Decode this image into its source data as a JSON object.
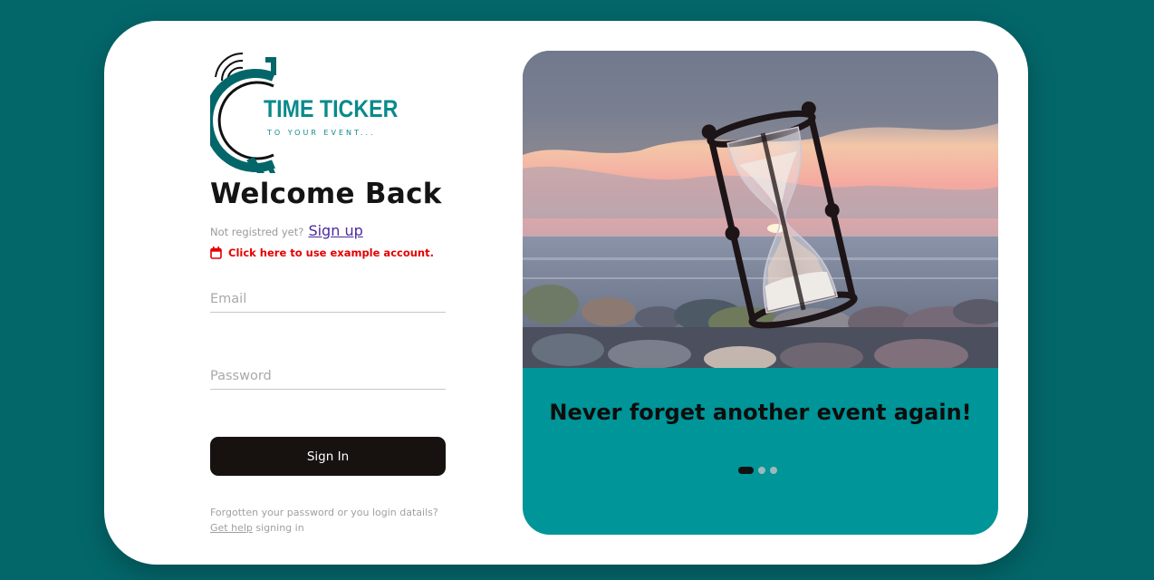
{
  "brand": {
    "name": "TIME TICKER",
    "tagline": "TO YOUR EVENT..."
  },
  "login": {
    "heading": "Welcome Back",
    "signup_prompt": "Not registred yet?",
    "signup_link": "Sign up",
    "example_account": "Click here to use example account.",
    "email_placeholder": "Email",
    "password_placeholder": "Password",
    "signin_label": "Sign In",
    "help_text": "Forgotten your password or you login datails?",
    "help_link": "Get help",
    "help_suffix": "signing in"
  },
  "carousel": {
    "slogan": "Never forget another event again!",
    "slide_count": 3,
    "active_slide": 1
  },
  "colors": {
    "background": "#03676a",
    "brand_teal": "#0a8a8c",
    "panel_teal": "#009598",
    "button_dark": "#171210",
    "error_red": "#e50000"
  },
  "icons": [
    "alarm-clock-logo-icon",
    "calendar-icon"
  ]
}
